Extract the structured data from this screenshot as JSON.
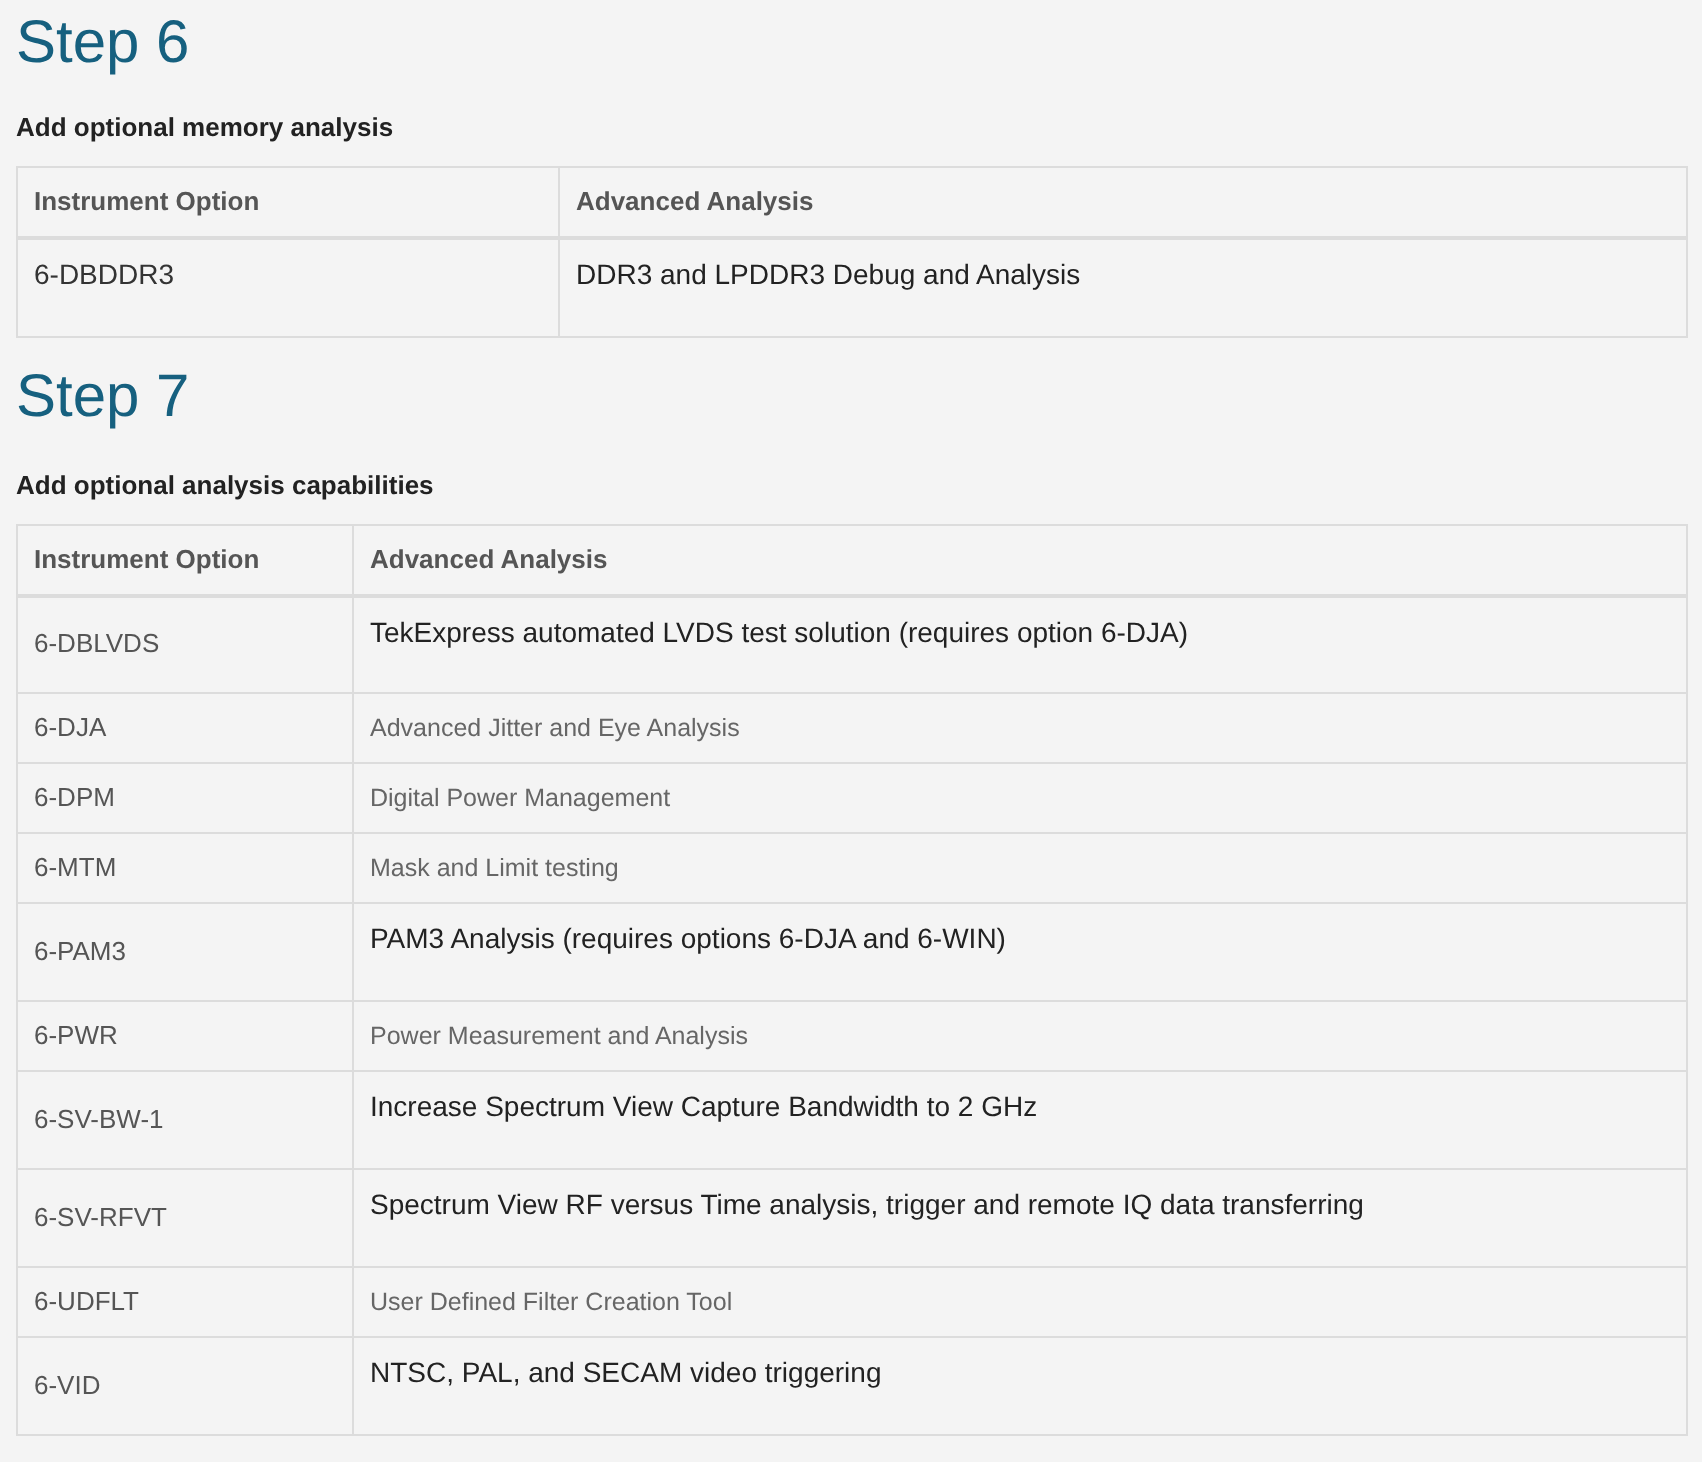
{
  "steps": [
    {
      "title": "Step 6",
      "subtitle": "Add optional memory analysis",
      "table": {
        "columns": [
          "Instrument Option",
          "Advanced Analysis"
        ],
        "rows": [
          {
            "option": "6-DBDDR3",
            "description": "DDR3 and LPDDR3 Debug and Analysis",
            "kind": "paragraph"
          }
        ]
      }
    },
    {
      "title": "Step 7",
      "subtitle": "Add optional analysis capabilities",
      "table": {
        "columns": [
          "Instrument Option",
          "Advanced Analysis"
        ],
        "rows": [
          {
            "option": "6-DBLVDS",
            "description": "TekExpress automated LVDS test solution (requires option 6-DJA)",
            "kind": "paragraph"
          },
          {
            "option": "6-DJA",
            "description": "Advanced Jitter and Eye Analysis",
            "kind": "plain"
          },
          {
            "option": "6-DPM",
            "description": "Digital Power Management",
            "kind": "plain"
          },
          {
            "option": "6-MTM",
            "description": "Mask and Limit testing",
            "kind": "plain"
          },
          {
            "option": "6-PAM3",
            "description": "PAM3 Analysis (requires options 6-DJA and 6-WIN)",
            "kind": "paragraph"
          },
          {
            "option": "6-PWR",
            "description": "Power Measurement and Analysis",
            "kind": "plain"
          },
          {
            "option": "6-SV-BW-1",
            "description": "Increase Spectrum View Capture Bandwidth to 2 GHz",
            "kind": "paragraph"
          },
          {
            "option": "6-SV-RFVT",
            "description": "Spectrum View RF versus Time analysis, trigger and remote IQ data transferring",
            "kind": "paragraph"
          },
          {
            "option": "6-UDFLT",
            "description": "User Defined Filter Creation Tool",
            "kind": "plain"
          },
          {
            "option": "6-VID",
            "description": "NTSC, PAL, and SECAM video triggering",
            "kind": "paragraph"
          }
        ]
      }
    }
  ]
}
